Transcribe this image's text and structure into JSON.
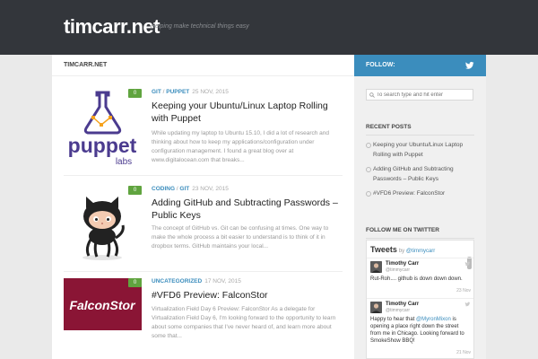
{
  "header": {
    "site_title": "timcarr.net",
    "tagline": "Helping make technical things easy"
  },
  "breadcrumb": "TIMCARR.NET",
  "posts": [
    {
      "categories": [
        "GIT",
        "PUPPET"
      ],
      "date": "25 NOV, 2015",
      "title": "Keeping your Ubuntu/Linux Laptop Rolling with Puppet",
      "excerpt": "While updating my laptop to Ubuntu 15.10, I did a lot of research and thinking about how to keep my applications/configuration under configuration management. I found a great blog over at www.digitalocean.com that breaks...",
      "comments": "0",
      "thumb_logo_main": "puppet",
      "thumb_logo_sub": "labs"
    },
    {
      "categories": [
        "CODING",
        "GIT"
      ],
      "date": "23 NOV, 2015",
      "title": "Adding GitHub and Subtracting Passwords – Public Keys",
      "excerpt": "The concept of GitHub vs. Git can be confusing at times. One way to make the whole process a bit easier to understand is to think of it in dropbox terms. GitHub maintains your local...",
      "comments": "0"
    },
    {
      "categories": [
        "UNCATEGORIZED"
      ],
      "date": "17 NOV, 2015",
      "title": "#VFD6 Preview: FalconStor",
      "excerpt": "Virtualization Field Day 6 Preview: FalconStor As a delegate for Virtualization Field Day 6, I'm looking forward to the opportunity to learn about some companies that I've never heard of, and learn more about some that...",
      "comments": "0",
      "thumb_logo_main": "FalconStor"
    }
  ],
  "sidebar": {
    "follow_label": "FOLLOW:",
    "search_placeholder": "To search type and hit enter",
    "recent_posts_title": "RECENT POSTS",
    "recent_posts": [
      "Keeping your Ubuntu/Linux Laptop Rolling with Puppet",
      "Adding GitHub and Subtracting Passwords – Public Keys",
      "#VFD6 Preview: FalconStor"
    ],
    "twitter_title": "FOLLOW ME ON TWITTER",
    "twitter": {
      "heading": "Tweets",
      "by": "by",
      "handle": "@timmycarr",
      "tweets": [
        {
          "name": "Timothy Carr",
          "handle": "@timmycarr",
          "text": "Rut-Roh.... github is down down down.",
          "time": "23 Nov"
        },
        {
          "name": "Timothy Carr",
          "handle": "@timmycarr",
          "text_before": "Happy to hear that ",
          "mention": "@MyronMixon",
          "text_after": " is opening a place right down the street from me in Chicago. Looking forward to SmokeShow BBQ!",
          "time": "21 Nov"
        }
      ]
    }
  },
  "colors": {
    "header_bg": "#33363b",
    "accent_blue": "#3b8dbd",
    "comment_green": "#60a43f",
    "falconstor_bg": "#8a1535",
    "puppet_purple": "#4b3b8f"
  }
}
